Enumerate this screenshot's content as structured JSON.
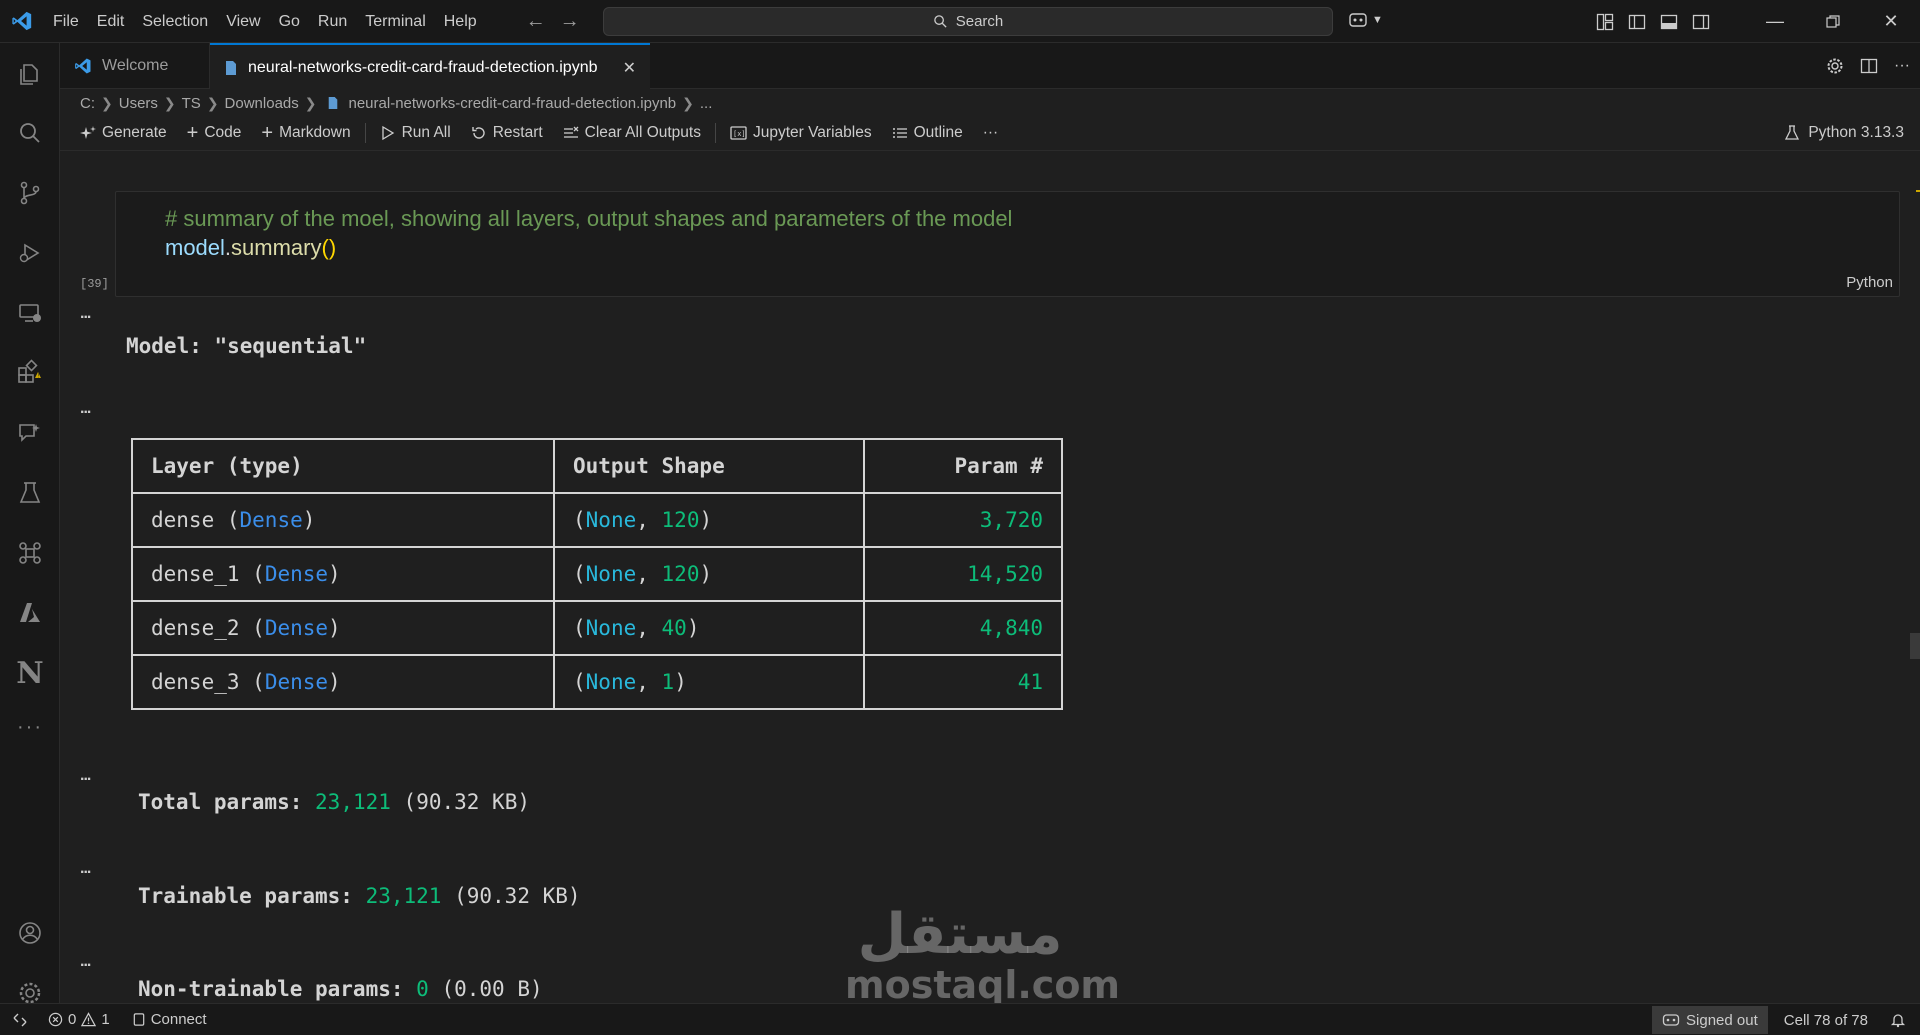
{
  "menu": [
    "File",
    "Edit",
    "Selection",
    "View",
    "Go",
    "Run",
    "Terminal",
    "Help"
  ],
  "search": {
    "label": "Search"
  },
  "tabs": {
    "welcome": "Welcome",
    "active": "neural-networks-credit-card-fraud-detection.ipynb"
  },
  "breadcrumb": [
    "C:",
    "Users",
    "TS",
    "Downloads",
    "neural-networks-credit-card-fraud-detection.ipynb",
    "..."
  ],
  "toolbar": {
    "generate": "Generate",
    "code": "Code",
    "markdown": "Markdown",
    "run_all": "Run All",
    "restart": "Restart",
    "clear_outputs": "Clear All Outputs",
    "jupyter_vars": "Jupyter Variables",
    "outline": "Outline",
    "more": "···",
    "kernel": "Python 3.13.3"
  },
  "cell": {
    "comment": "# summary of the moel, showing all layers, output shapes and parameters of the model",
    "code_obj": "model",
    "code_dot": ".",
    "code_fn": "summary",
    "code_parens": "()",
    "language": "Python",
    "exec_count": "[39]"
  },
  "output": {
    "dots": "...",
    "model_line": "Model: \"sequential\"",
    "table": {
      "headers": [
        "Layer (type)",
        "Output Shape",
        "Param #"
      ],
      "rows": [
        {
          "name": "dense",
          "type": "Dense",
          "shape_none": "None",
          "shape_dim": "120",
          "params": "3,720"
        },
        {
          "name": "dense_1",
          "type": "Dense",
          "shape_none": "None",
          "shape_dim": "120",
          "params": "14,520"
        },
        {
          "name": "dense_2",
          "type": "Dense",
          "shape_none": "None",
          "shape_dim": "40",
          "params": "4,840"
        },
        {
          "name": "dense_3",
          "type": "Dense",
          "shape_none": "None",
          "shape_dim": "1",
          "params": "41"
        }
      ]
    },
    "total": {
      "label": "Total params:",
      "value": "23,121",
      "size": "(90.32 KB)"
    },
    "trainable": {
      "label": "Trainable params:",
      "value": "23,121",
      "size": "(90.32 KB)"
    },
    "non_trainable": {
      "label": "Non-trainable params:",
      "value": "0",
      "size": "(0.00 B)"
    }
  },
  "watermark": {
    "arabic": "مستقل",
    "latin": "mostaql.com"
  },
  "status": {
    "errors": "0",
    "warnings": "1",
    "connect": "Connect",
    "signed_out": "Signed out",
    "cell_pos": "Cell 78 of 78"
  },
  "icons": [
    "vscode-logo-icon",
    "files-icon",
    "search-icon",
    "source-control-icon",
    "run-debug-icon",
    "remote-explorer-icon",
    "extensions-icon",
    "chat-icon",
    "testing-icon",
    "api-icon",
    "azure-icon",
    "notion-icon",
    "more-icon",
    "account-icon",
    "settings-icon"
  ],
  "colors": {
    "accent": "#0078d4",
    "comment": "#6a9955",
    "variable": "#9cdcfe",
    "function": "#dcdcaa",
    "number": "#23d18b",
    "type": "#3b8eea"
  }
}
